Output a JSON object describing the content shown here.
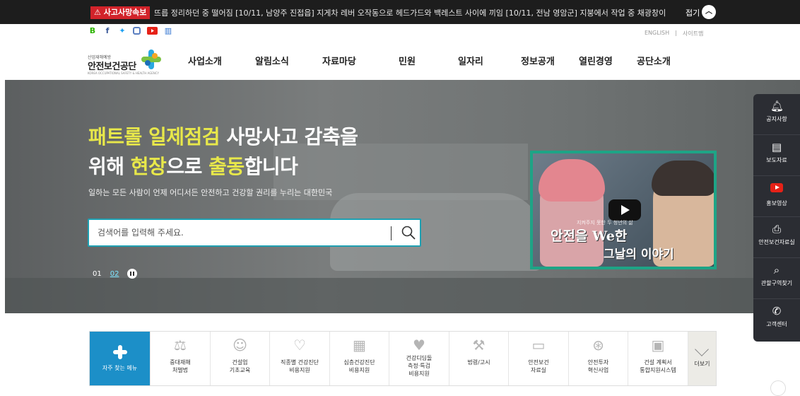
{
  "alert": {
    "badge": "사고사망속보",
    "ticker": "뜨릅 정리하던 중 떨어짐   [10/11, 남양주 진접읍] 지게차 레버 오작동으로 헤드가드와 백레스트 사이에 끼임   [10/11, 전남 영암군] 지붕에서 작업 중 채광창이",
    "fold_label": "접기"
  },
  "social": {
    "icons": [
      "blog-icon",
      "facebook-icon",
      "twitter-icon",
      "instagram-icon",
      "youtube-icon",
      "book-icon"
    ],
    "colors": {
      "blog": "#2db400",
      "facebook": "#3b5998",
      "twitter": "#1da1f2",
      "instagram": "#5a7ec0",
      "youtube": "#e62117",
      "book": "#2a6fcf"
    }
  },
  "toplinks": {
    "english": "ENGLISH",
    "sep": "|",
    "sitemap": "사이트맵"
  },
  "logo": {
    "small": "산업재해예방",
    "name": "안전보건공단",
    "eng": "KOREA OCCUPATIONAL SAFETY & HEALTH AGENCY"
  },
  "menu": [
    "사업소개",
    "알림소식",
    "자료마당",
    "민원",
    "일자리",
    "정보공개",
    "열린경영",
    "공단소개"
  ],
  "hero": {
    "line1_yellow": "패트롤 일제점검",
    "line1_white": " 사망사고 감축을",
    "line2_a": "위해 ",
    "line2_yellow1": "현장",
    "line2_b": "으로 ",
    "line2_yellow2": "출동",
    "line2_c": "합니다",
    "sub": "일하는 모든 사람이 언제 어디서든 안전하고 건강할 권리를 누리는 대한민국",
    "search_placeholder": "검색어를 입력해 주세요.",
    "pager_1": "01",
    "pager_2": "02"
  },
  "video": {
    "caption": "지켜주지 못한 두 청년의 삶",
    "title1": "안전을 We한",
    "title2": "그날의 이야기"
  },
  "quick": [
    {
      "icon": "bell-icon",
      "label": "공지사항"
    },
    {
      "icon": "document-icon",
      "label": "보도자료"
    },
    {
      "icon": "youtube-icon",
      "label": "홍보영상"
    },
    {
      "icon": "printer-icon",
      "label": "안전보건자료실"
    },
    {
      "icon": "search-icon",
      "label": "관할구역찾기"
    },
    {
      "icon": "phone-icon",
      "label": "고객센터"
    }
  ],
  "freq": {
    "main_label": "자주 찾는 메뉴",
    "items": [
      {
        "icon": "scale-icon",
        "label": "중대재해\n처벌법"
      },
      {
        "icon": "worker-icon",
        "label": "건설업\n기초교육"
      },
      {
        "icon": "stethoscope-icon",
        "label": "직종별 건강진단\n비용지원"
      },
      {
        "icon": "hospital-icon",
        "label": "심층건강진단\n비용지원"
      },
      {
        "icon": "heartbeat-icon",
        "label": "건강디딤돌\n측정·특검\n비용지원"
      },
      {
        "icon": "gavel-icon",
        "label": "법령/고시"
      },
      {
        "icon": "folder-icon",
        "label": "안전보건\n자료실"
      },
      {
        "icon": "coin-icon",
        "label": "안전투자\n혁신사업"
      },
      {
        "icon": "monitor-icon",
        "label": "건설 계획서\n통합지원시스템"
      }
    ],
    "more_label": "더보기"
  },
  "colors": {
    "accent": "#1ea0b2",
    "main_blue": "#1c8fc8",
    "yellow": "#e8e84a",
    "alert_red": "#d2232a",
    "video_border": "#1ea486"
  }
}
